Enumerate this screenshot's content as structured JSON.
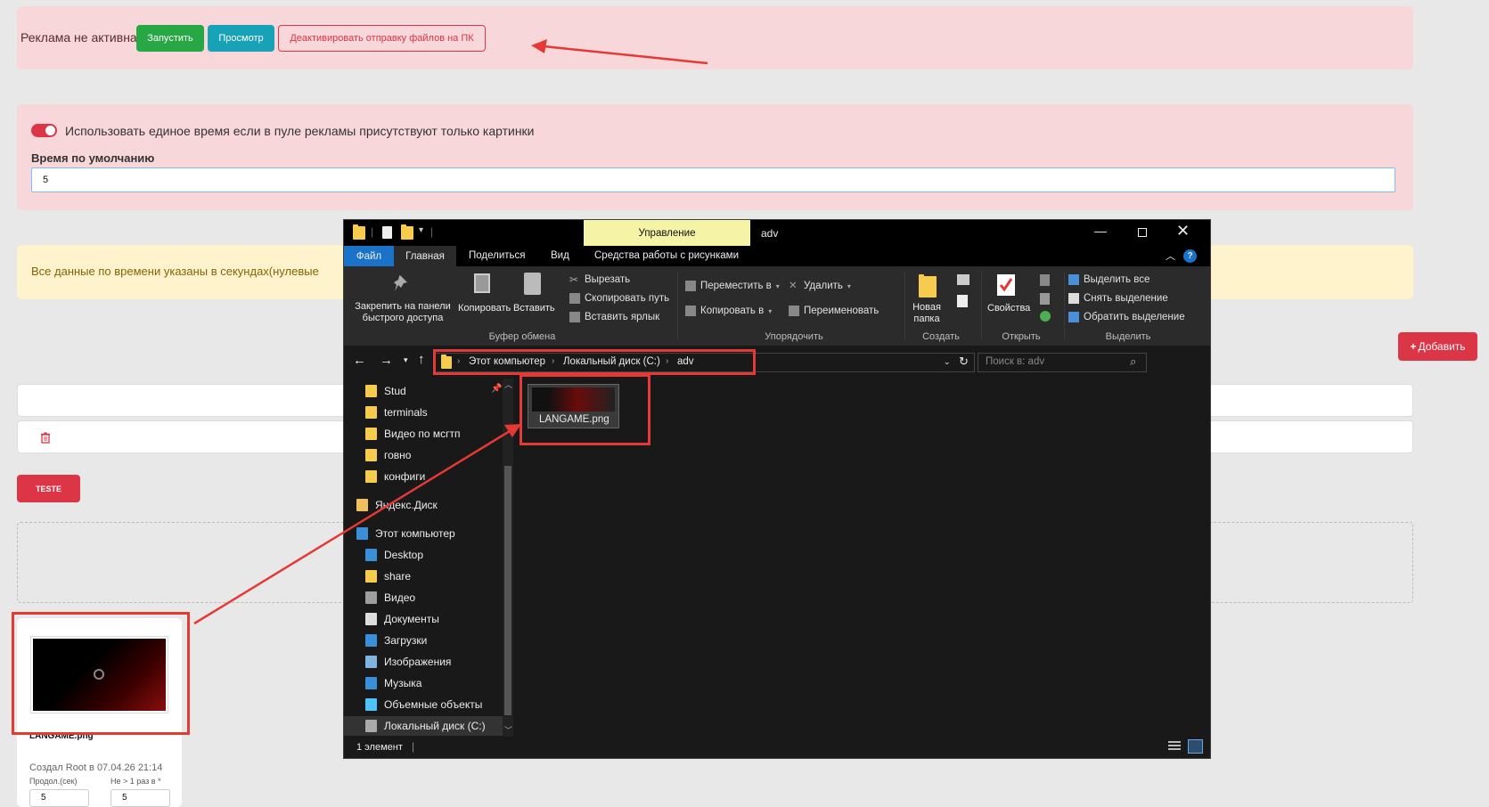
{
  "ad_panel": {
    "status_text": "Реклама не активна",
    "start_label": "Запустить",
    "preview_label": "Просмотр",
    "deactivate_label": "Деактивировать отправку файлов на ПК"
  },
  "time_panel": {
    "toggle_label": "Использовать единое время если в пуле рекламы присутствуют только картинки",
    "default_time_label": "Время по умолчанию",
    "default_time_value": "5"
  },
  "info_panel": {
    "text": "Все данные по времени указаны в секундах(нулевые"
  },
  "add_button_label": "Добавить",
  "teste_button_label": "TESTE",
  "card": {
    "filename": "LANGAME.png",
    "created": "Создал Root в 07.04.26 21:14",
    "duration_label": "Продол.(сек)",
    "frequency_label": "Не > 1 раз в *",
    "duration_value": "5",
    "frequency_value": "5"
  },
  "explorer": {
    "title": "adv",
    "context_tab": "Управление",
    "tabs": [
      "Файл",
      "Главная",
      "Поделиться",
      "Вид",
      "Средства работы с рисунками"
    ],
    "ribbon": {
      "pin": "Закрепить на панели быстрого доступа",
      "copy": "Копировать",
      "paste": "Вставить",
      "cut": "Вырезать",
      "copy_path": "Скопировать путь",
      "paste_shortcut": "Вставить ярлык",
      "group_clipboard": "Буфер обмена",
      "move_to": "Переместить в",
      "copy_to": "Копировать в",
      "delete": "Удалить",
      "rename": "Переименовать",
      "group_organize": "Упорядочить",
      "new_folder": "Новая папка",
      "group_create": "Создать",
      "properties": "Свойства",
      "group_open": "Открыть",
      "select_all": "Выделить все",
      "select_none": "Снять выделение",
      "invert_selection": "Обратить выделение",
      "group_select": "Выделить"
    },
    "breadcrumb": [
      "Этот компьютер",
      "Локальный диск (C:)",
      "adv"
    ],
    "search_placeholder": "Поиск в: adv",
    "nav_items": [
      "Stud",
      "terminals",
      "Видео по мсгтп",
      "говно",
      "конфиги",
      "Яндекс.Диск",
      "Этот компьютер",
      "Desktop",
      "share",
      "Видео",
      "Документы",
      "Загрузки",
      "Изображения",
      "Музыка",
      "Объемные объекты",
      "Локальный диск (C:)"
    ],
    "file_name": "LANGAME.png",
    "status": "1 элемент"
  },
  "colors": {
    "danger": "#dc3545",
    "success": "#28a745",
    "info": "#17a2b8",
    "annotation": "#e53935"
  }
}
